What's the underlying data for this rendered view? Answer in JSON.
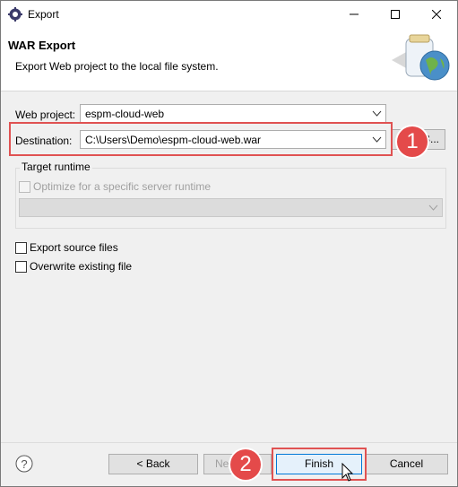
{
  "window": {
    "title": "Export",
    "icons": {
      "app": "eclipse-gear-icon",
      "minimize": "minimize-icon",
      "maximize": "maximize-icon",
      "close": "close-icon"
    }
  },
  "header": {
    "title": "WAR Export",
    "subtitle": "Export Web project to the local file system.",
    "image": "web-export-globe-jar-icon"
  },
  "form": {
    "web_project": {
      "label": "Web project:",
      "value": "espm-cloud-web"
    },
    "destination": {
      "label": "Destination:",
      "value": "C:\\Users\\Demo\\espm-cloud-web.war",
      "browse_label": "B..."
    },
    "target_runtime": {
      "group_title": "Target runtime",
      "optimize_label": "Optimize for a specific server runtime",
      "optimize_checked": false,
      "runtime_value": ""
    },
    "export_source": {
      "label": "Export source files",
      "checked": false
    },
    "overwrite": {
      "label": "Overwrite existing file",
      "checked": false
    }
  },
  "annotations": {
    "step1": "1",
    "step2": "2",
    "color": "#e44a4a"
  },
  "footer": {
    "help_icon": "help-question-icon",
    "back_label": "< Back",
    "next_label": "Ne",
    "finish_label": "Finish",
    "cancel_label": "Cancel"
  }
}
